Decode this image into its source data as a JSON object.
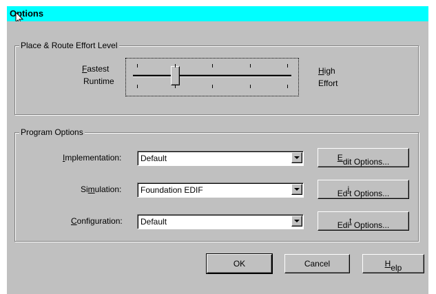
{
  "window": {
    "title": "Options"
  },
  "effort_group": {
    "title": "Place & Route Effort Level",
    "left_label_1_key": "F",
    "left_label_1_rest": "astest",
    "left_label_2": "Runtime",
    "right_label_1_key": "H",
    "right_label_1_rest": "igh",
    "right_label_2": "Effort",
    "slider_position": 0.25,
    "tick_count": 5
  },
  "program_group": {
    "title": "Program Options",
    "rows": [
      {
        "label_key": "I",
        "label_rest": "mplementation:",
        "value": "Default",
        "btn_pre": "",
        "btn_key": "E",
        "btn_rest": "dit Options..."
      },
      {
        "label_pre": "Si",
        "label_key": "m",
        "label_rest": "ulation:",
        "value": "Foundation EDIF",
        "btn_pre": "Ed",
        "btn_key": "i",
        "btn_rest": "t Options..."
      },
      {
        "label_key": "C",
        "label_rest": "onfiguration:",
        "value": "Default",
        "btn_pre": "Edi",
        "btn_key": "t",
        "btn_rest": " Options..."
      }
    ]
  },
  "buttons": {
    "ok": "OK",
    "cancel": "Cancel",
    "help_key": "H",
    "help_rest": "elp"
  },
  "colors": {
    "titlebar": "#00ffff",
    "face": "#c0c0c0"
  }
}
